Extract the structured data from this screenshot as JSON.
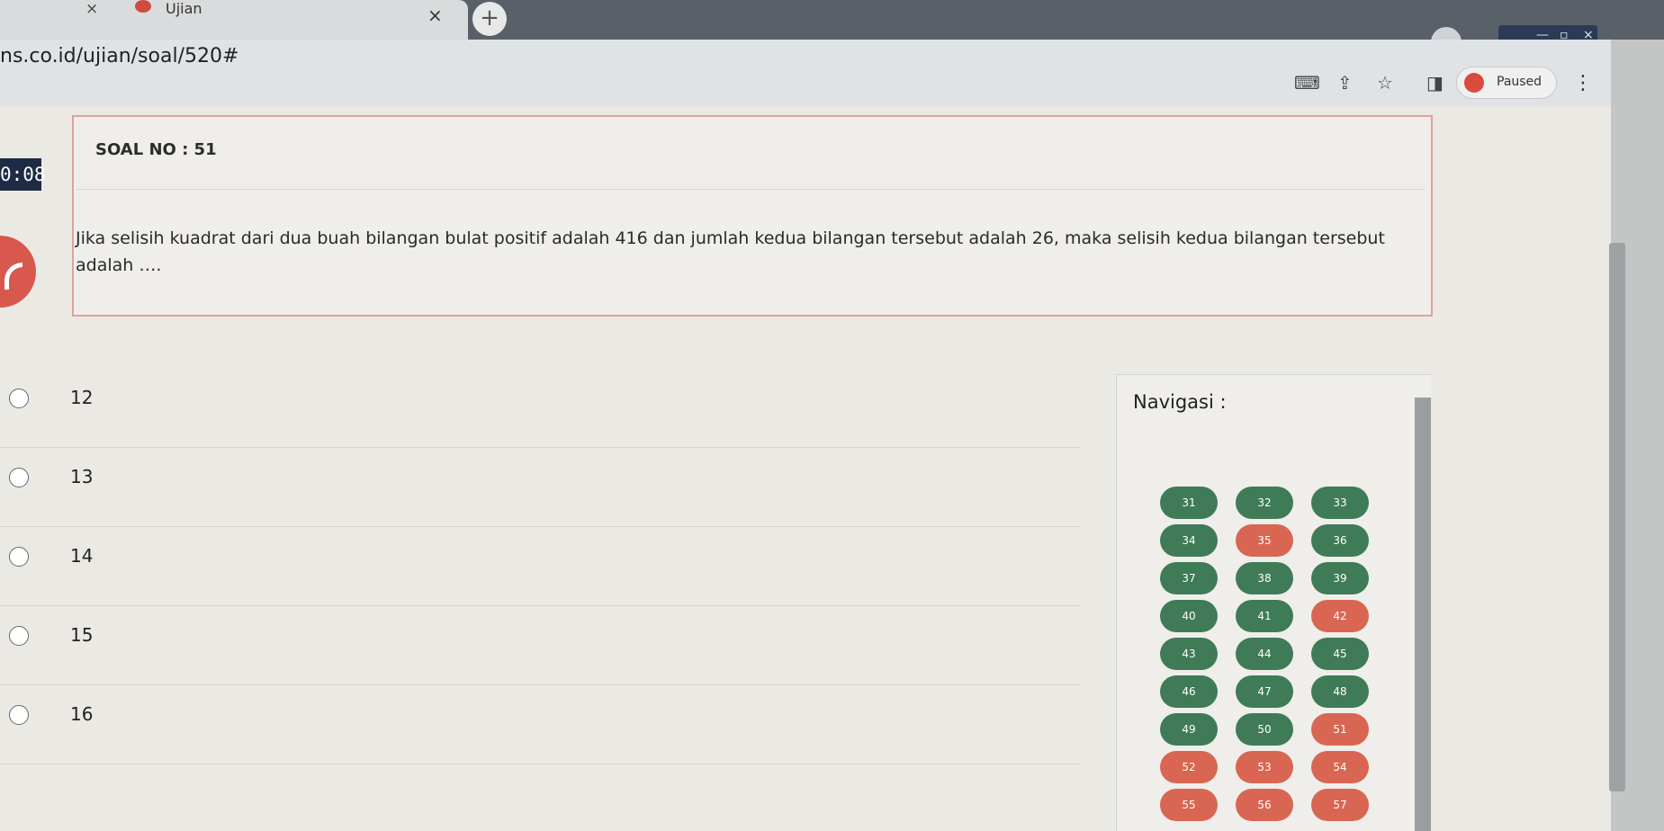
{
  "browser": {
    "tab_title": "Ujian",
    "tab_close_left": "×",
    "tab_close": "×",
    "new_tab": "+",
    "url": "ns.co.id/ujian/soal/520#",
    "profile_status": "Paused",
    "menu": "⋮"
  },
  "timer": {
    "value": "0:08"
  },
  "question": {
    "title": "SOAL NO : 51",
    "text": "Jika selisih kuadrat dari dua buah bilangan bulat positif adalah 416 dan jumlah kedua bilangan tersebut adalah 26, maka selisih kedua bilangan tersebut adalah …."
  },
  "options": [
    "12",
    "13",
    "14",
    "15",
    "16"
  ],
  "navigation": {
    "title": "Navigasi :",
    "buttons": [
      {
        "label": "31",
        "status": "answered"
      },
      {
        "label": "32",
        "status": "answered"
      },
      {
        "label": "33",
        "status": "answered"
      },
      {
        "label": "34",
        "status": "answered"
      },
      {
        "label": "35",
        "status": "unanswered"
      },
      {
        "label": "36",
        "status": "answered"
      },
      {
        "label": "37",
        "status": "answered"
      },
      {
        "label": "38",
        "status": "answered"
      },
      {
        "label": "39",
        "status": "answered"
      },
      {
        "label": "40",
        "status": "answered"
      },
      {
        "label": "41",
        "status": "answered"
      },
      {
        "label": "42",
        "status": "unanswered"
      },
      {
        "label": "43",
        "status": "answered"
      },
      {
        "label": "44",
        "status": "answered"
      },
      {
        "label": "45",
        "status": "answered"
      },
      {
        "label": "46",
        "status": "answered"
      },
      {
        "label": "47",
        "status": "answered"
      },
      {
        "label": "48",
        "status": "answered"
      },
      {
        "label": "49",
        "status": "answered"
      },
      {
        "label": "50",
        "status": "answered"
      },
      {
        "label": "51",
        "status": "unanswered"
      },
      {
        "label": "52",
        "status": "unanswered"
      },
      {
        "label": "53",
        "status": "unanswered"
      },
      {
        "label": "54",
        "status": "unanswered"
      },
      {
        "label": "55",
        "status": "unanswered"
      },
      {
        "label": "56",
        "status": "unanswered"
      },
      {
        "label": "57",
        "status": "unanswered"
      }
    ]
  },
  "colors": {
    "answered": "#3f7b57",
    "unanswered": "#d96652",
    "timer_bg": "#1f2a44"
  }
}
